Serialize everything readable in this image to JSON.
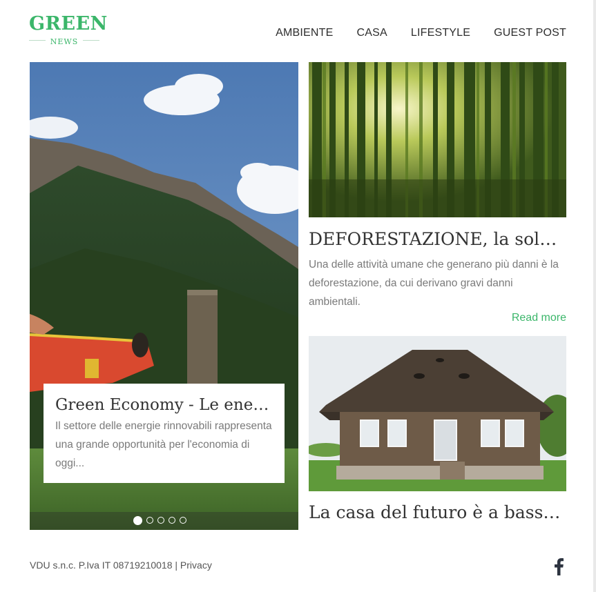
{
  "logo": {
    "main": "GREEN",
    "sub": "NEWS"
  },
  "nav": {
    "items": [
      "AMBIENTE",
      "CASA",
      "LIFESTYLE",
      "GUEST POST"
    ]
  },
  "hero": {
    "title": "Green Economy - Le energie rinnovabili",
    "text": "Il settore delle energie rinnovabili rappresenta una grande opportunità per l'economia di oggi...",
    "slides_count": 5,
    "active_slide": 1
  },
  "articles": [
    {
      "title": "DEFORESTAZIONE, la soluzione",
      "excerpt": "Una delle attività umane che generano più danni è la deforestazione, da cui derivano gravi danni ambientali.",
      "read_more": "Read more"
    },
    {
      "title": "La casa del futuro è a basso impatto"
    }
  ],
  "footer": {
    "text": "VDU s.n.c. P.Iva IT 08719210018 | Privacy",
    "social_icon": "facebook-icon"
  },
  "colors": {
    "accent": "#3bb66a",
    "text_dark": "#333333",
    "text_muted": "#7a7a7a"
  }
}
